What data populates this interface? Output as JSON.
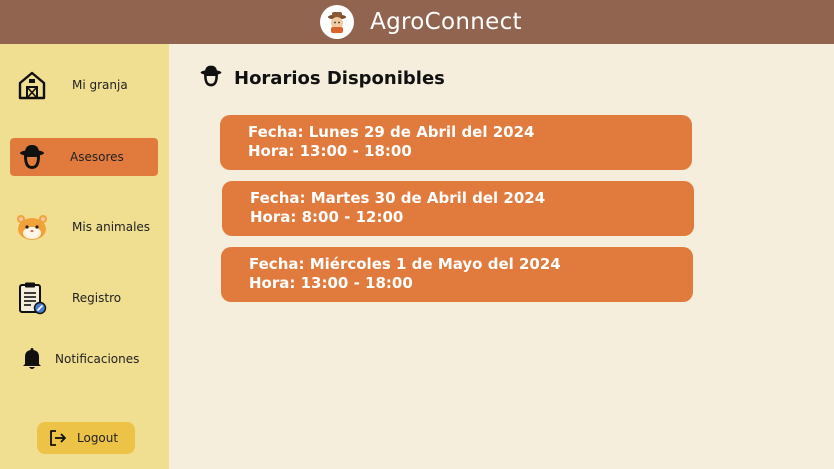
{
  "app": {
    "title": "AgroConnect"
  },
  "sidebar": {
    "items": [
      {
        "label": "Mi granja",
        "icon": "barn-icon",
        "active": false
      },
      {
        "label": "Asesores",
        "icon": "farmer-hat-icon",
        "active": true
      },
      {
        "label": "Mis animales",
        "icon": "hamster-icon",
        "active": false
      },
      {
        "label": "Registro",
        "icon": "clipboard-icon",
        "active": false
      },
      {
        "label": "Notificaciones",
        "icon": "bell-icon",
        "active": false
      }
    ],
    "logout_label": "Logout"
  },
  "main": {
    "title": "Horarios Disponibles",
    "slots": [
      {
        "fecha": "Fecha: Lunes 29 de Abril del 2024",
        "hora": "Hora: 13:00 - 18:00"
      },
      {
        "fecha": "Fecha: Martes 30 de Abril del 2024",
        "hora": "Hora: 8:00 - 12:00"
      },
      {
        "fecha": "Fecha: Miércoles 1 de Mayo del 2024",
        "hora": "Hora: 13:00 - 18:00"
      }
    ]
  },
  "colors": {
    "header": "#916450",
    "sidebar": "#f0de91",
    "accent": "#e07b3d",
    "background": "#f6eedd",
    "logout": "#edc347"
  }
}
